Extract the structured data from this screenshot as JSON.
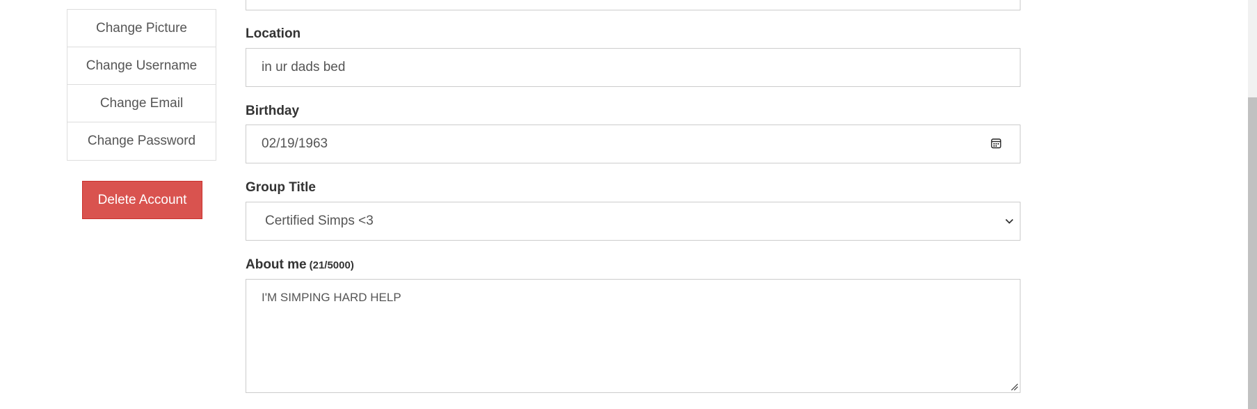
{
  "sidebar": {
    "items": [
      {
        "label": "Change Picture"
      },
      {
        "label": "Change Username"
      },
      {
        "label": "Change Email"
      },
      {
        "label": "Change Password"
      }
    ],
    "delete_label": "Delete Account"
  },
  "form": {
    "location": {
      "label": "Location",
      "value": "in ur dads bed"
    },
    "birthday": {
      "label": "Birthday",
      "value": "02/19/1963"
    },
    "group_title": {
      "label": "Group Title",
      "selected": "Certified Simps <3"
    },
    "about": {
      "label": "About me",
      "counter": "(21/5000)",
      "value": "I'M SIMPING HARD HELP"
    }
  },
  "colors": {
    "danger": "#d9534f",
    "border": "#cccccc",
    "text": "#333333"
  }
}
